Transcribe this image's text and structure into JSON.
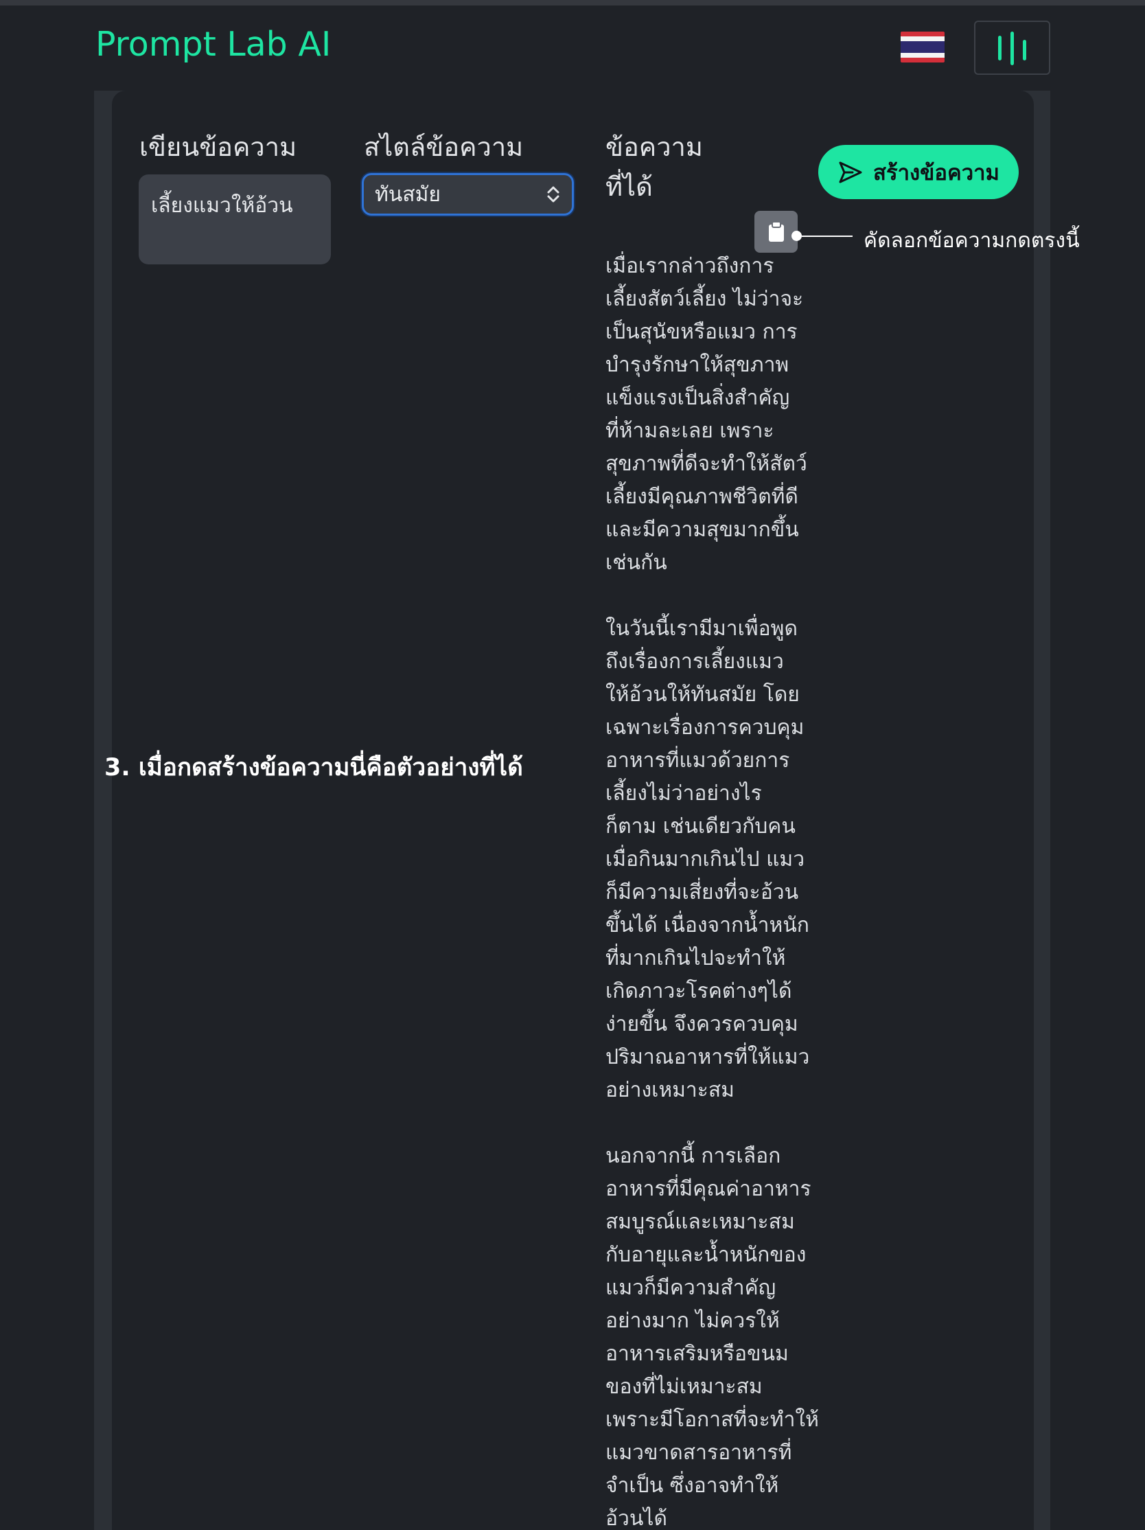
{
  "app": {
    "title": "Prompt Lab AI"
  },
  "header": {
    "language_flag_icon": "thai-flag-icon",
    "menu_icon": "equalizer-menu-icon"
  },
  "colors": {
    "accent": "#1ee5a2",
    "background": "#1f2227",
    "panel_border": "#2c3036",
    "input_bg": "#3c4048",
    "select_focus": "#2f73d6",
    "copy_button": "#6a6e76"
  },
  "form": {
    "prompt_label": "เขียนข้อความ",
    "prompt_value": "เลี้ยงแมวให้อ้วน",
    "style_label": "สไตล์ข้อความ",
    "style_selected": "ทันสมัย",
    "output_label_line1": "ข้อความ",
    "output_label_line2": "ที่ได้",
    "generate_label": "สร้างข้อความ"
  },
  "output": {
    "copy_icon": "clipboard-icon",
    "lines": [
      "เมื่อเรากล่าวถึงการ",
      "เลี้ยงสัตว์เลี้ยง ไม่ว่าจะ",
      "เป็นสุนัขหรือแมว การ",
      "บำรุงรักษาให้สุขภาพ",
      "แข็งแรงเป็นสิ่งสำคัญ",
      "ที่ห้ามละเลย เพราะ",
      "สุขภาพที่ดีจะทำให้สัตว์",
      "เลี้ยงมีคุณภาพชีวิตที่ดี",
      "และมีความสุขมากขึ้น",
      "เช่นกัน",
      "",
      "ในวันนี้เรามีมาเพื่อพูด",
      "ถึงเรื่องการเลี้ยงแมว",
      "ให้อ้วนให้ทันสมัย โดย",
      "เฉพาะเรื่องการควบคุม",
      "อาหารที่แมวด้วยการ",
      "เลี้ยงไม่ว่าอย่างไร",
      "ก็ตาม เช่นเดียวกับคน",
      "เมื่อกินมากเกินไป แมว",
      "ก็มีความเสี่ยงที่จะอ้วน",
      "ขึ้นได้ เนื่องจากน้ำหนัก",
      "ที่มากเกินไปจะทำให้",
      "เกิดภาวะโรคต่างๆได้",
      "ง่ายขึ้น จึงควรควบคุม",
      "ปริมาณอาหารที่ให้แมว",
      "อย่างเหมาะสม",
      "",
      "นอกจากนี้ การเลือก",
      "อาหารที่มีคุณค่าอาหาร",
      "สมบูรณ์และเหมาะสม",
      "กับอายุและน้ำหนักของ",
      "แมวก็มีความสำคัญ",
      "อย่างมาก ไม่ควรให้",
      "อาหารเสริมหรือขนม",
      "ของที่ไม่เหมาะสม",
      "เพราะมีโอกาสที่จะทำให้",
      "แมวขาดสารอาหารที่",
      "จำเป็น ซึ่งอาจทำให้",
      "อ้วนได้"
    ]
  },
  "annotations": {
    "copy_hint": "คัดลอกข้อความกดตรงนี้",
    "step_caption": "3. เมื่อกดสร้างข้อความนี่คือตัวอย่างที่ได้"
  }
}
